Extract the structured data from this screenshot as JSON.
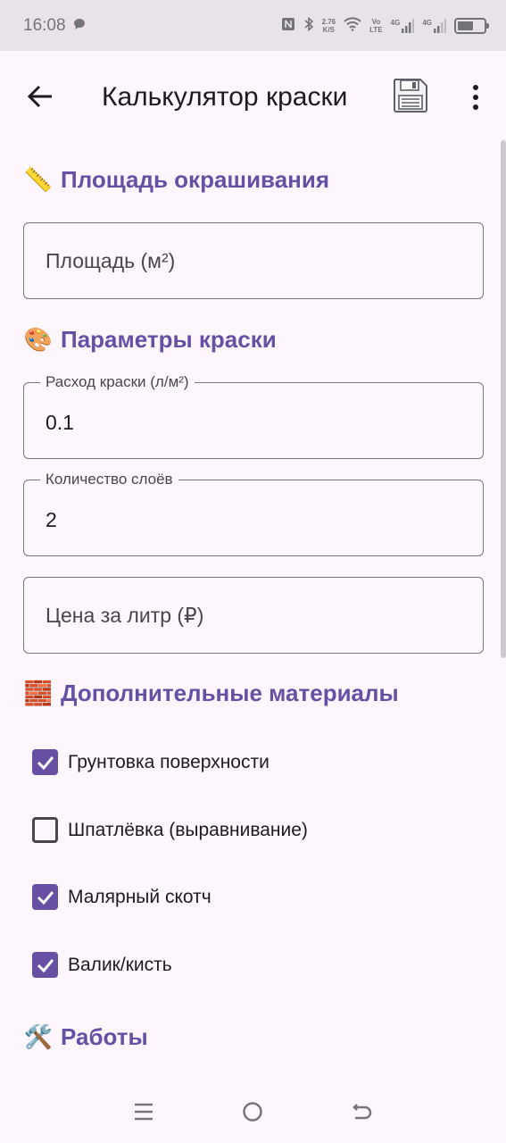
{
  "status_bar": {
    "time": "16:08",
    "net_speed_value": "2.76",
    "net_speed_unit": "K/S",
    "volte_top": "Vo",
    "volte_bottom": "LTE",
    "sig1_label": "4G",
    "sig2_label": "4G"
  },
  "app_bar": {
    "title": "Калькулятор краски"
  },
  "sections": {
    "area": {
      "emoji": "📏",
      "title": "Площадь окрашивания"
    },
    "paint": {
      "emoji": "🎨",
      "title": "Параметры краски"
    },
    "extra": {
      "emoji": "🧱",
      "title": "Дополнительные материалы"
    },
    "works": {
      "emoji": "🛠️",
      "title": "Работы"
    }
  },
  "fields": {
    "area": {
      "placeholder": "Площадь (м²)"
    },
    "consumption": {
      "label": "Расход краски (л/м²)",
      "value": "0.1"
    },
    "layers": {
      "label": "Количество слоёв",
      "value": "2"
    },
    "price": {
      "placeholder": "Цена за литр (₽)"
    }
  },
  "checkboxes": [
    {
      "label": "Грунтовка поверхности",
      "checked": true
    },
    {
      "label": "Шпатлёвка (выравнивание)",
      "checked": false
    },
    {
      "label": "Малярный скотч",
      "checked": true
    },
    {
      "label": "Валик/кисть",
      "checked": true
    }
  ],
  "colors": {
    "accent": "#6750a4",
    "background": "#fdf7fd",
    "status_bar": "#e8e3ea"
  }
}
